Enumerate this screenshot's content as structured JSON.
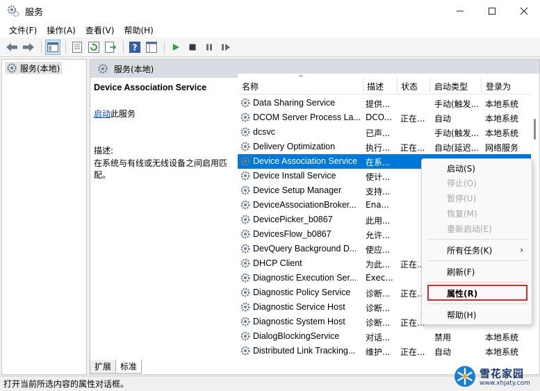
{
  "window": {
    "title": "服务",
    "minimize_icon": "minimize-icon",
    "maximize_icon": "maximize-icon",
    "close_icon": "close-icon"
  },
  "menubar": {
    "items": [
      "文件(F)",
      "操作(A)",
      "查看(V)",
      "帮助(H)"
    ]
  },
  "toolbar": {
    "icons": [
      "back-arrow-icon",
      "forward-arrow-icon",
      "show-tree-icon",
      "properties-sheet-icon",
      "refresh-icon",
      "export-list-icon",
      "help-icon",
      "console-view-icon",
      "play-icon",
      "stop-icon",
      "pause-icon",
      "restart-icon"
    ]
  },
  "tree": {
    "root_label": "服务(本地)"
  },
  "pane_header": {
    "label": "服务(本地)"
  },
  "description": {
    "service_title": "Device Association Service",
    "action_link": "启动",
    "action_suffix": "此服务",
    "desc_label": "描述:",
    "desc_text": "在系统与有线或无线设备之间启用匹配。"
  },
  "columns": {
    "name": "名称",
    "desc": "描述",
    "status": "状态",
    "startup": "启动类型",
    "logon": "登录为"
  },
  "rows": [
    {
      "name": "Data Sharing Service",
      "desc": "提供...",
      "status": "",
      "startup": "手动(触发...",
      "logon": "本地系统"
    },
    {
      "name": "DCOM Server Process La...",
      "desc": "DCO...",
      "status": "正在...",
      "startup": "自动",
      "logon": "本地系统"
    },
    {
      "name": "dcsvc",
      "desc": "已声...",
      "status": "",
      "startup": "手动(触发...",
      "logon": "本地系统"
    },
    {
      "name": "Delivery Optimization",
      "desc": "执行...",
      "status": "正在...",
      "startup": "自动(延迟...",
      "logon": "网络服务"
    },
    {
      "name": "Device Association Service",
      "desc": "在系...",
      "status": "",
      "startup": "",
      "logon": ""
    },
    {
      "name": "Device Install Service",
      "desc": "使计...",
      "status": "",
      "startup": "",
      "logon": ""
    },
    {
      "name": "Device Setup Manager",
      "desc": "支持...",
      "status": "",
      "startup": "",
      "logon": ""
    },
    {
      "name": "DeviceAssociationBroker...",
      "desc": "Ena...",
      "status": "",
      "startup": "",
      "logon": ""
    },
    {
      "name": "DevicePicker_b0867",
      "desc": "此用...",
      "status": "",
      "startup": "",
      "logon": ""
    },
    {
      "name": "DevicesFlow_b0867",
      "desc": "允许...",
      "status": "",
      "startup": "",
      "logon": ""
    },
    {
      "name": "DevQuery Background D...",
      "desc": "使应...",
      "status": "",
      "startup": "",
      "logon": ""
    },
    {
      "name": "DHCP Client",
      "desc": "为此...",
      "status": "正在...",
      "startup": "",
      "logon": ""
    },
    {
      "name": "Diagnostic Execution Ser...",
      "desc": "Exec...",
      "status": "",
      "startup": "",
      "logon": ""
    },
    {
      "name": "Diagnostic Policy Service",
      "desc": "诊断...",
      "status": "正在...",
      "startup": "",
      "logon": ""
    },
    {
      "name": "Diagnostic Service Host",
      "desc": "诊断...",
      "status": "",
      "startup": "",
      "logon": ""
    },
    {
      "name": "Diagnostic System Host",
      "desc": "诊断...",
      "status": "正在...",
      "startup": "",
      "logon": ""
    },
    {
      "name": "DialogBlockingService",
      "desc": "对话...",
      "status": "",
      "startup": "禁用",
      "logon": "本地系统"
    },
    {
      "name": "Distributed Link Tracking...",
      "desc": "维护...",
      "status": "正在...",
      "startup": "自动",
      "logon": "本地系统"
    }
  ],
  "context_menu": {
    "items": [
      {
        "label": "启动(S)",
        "enabled": true
      },
      {
        "label": "停止(O)",
        "enabled": false
      },
      {
        "label": "暂停(U)",
        "enabled": false
      },
      {
        "label": "恢复(M)",
        "enabled": false
      },
      {
        "label": "重新启动(E)",
        "enabled": false
      },
      {
        "label": "所有任务(K)",
        "enabled": true,
        "submenu": true
      },
      {
        "label": "刷新(F)",
        "enabled": true
      },
      {
        "label": "属性(R)",
        "enabled": true,
        "highlighted": true
      },
      {
        "label": "帮助(H)",
        "enabled": true
      }
    ],
    "highlight_color": "#e0262a"
  },
  "tabs": [
    "扩展",
    "标准"
  ],
  "statusbar": {
    "text": "打开当前所选内容的属性对话框。"
  },
  "watermark": {
    "title": "雪花家园",
    "url": "www.xhjaty.com"
  },
  "colors": {
    "selection": "#0078d7",
    "link": "#0047b3",
    "header_bg": "#d8dde3"
  }
}
